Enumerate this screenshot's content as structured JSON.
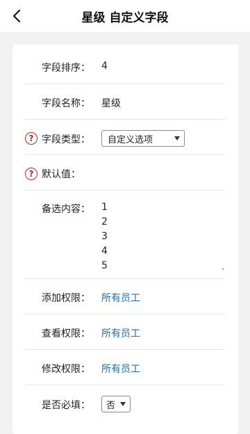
{
  "header": {
    "title": "星级 自定义字段"
  },
  "fields": {
    "sort": {
      "label": "字段排序：",
      "value": "4"
    },
    "name": {
      "label": "字段名称：",
      "value": "星级"
    },
    "type": {
      "label": "字段类型：",
      "value": "自定义选项"
    },
    "default": {
      "label": "默认值："
    },
    "options": {
      "label": "备选内容：",
      "values": [
        "1",
        "2",
        "3",
        "4",
        "5"
      ]
    },
    "add": {
      "label": "添加权限：",
      "value": "所有员工"
    },
    "view": {
      "label": "查看权限：",
      "value": "所有员工"
    },
    "edit": {
      "label": "修改权限：",
      "value": "所有员工"
    },
    "required": {
      "label": "是否必填：",
      "value": "否"
    }
  },
  "icons": {
    "back": "chevron-left-icon",
    "help": "question-circle-icon"
  },
  "colors": {
    "link": "#1a6fc1",
    "help": "#b3261e"
  }
}
